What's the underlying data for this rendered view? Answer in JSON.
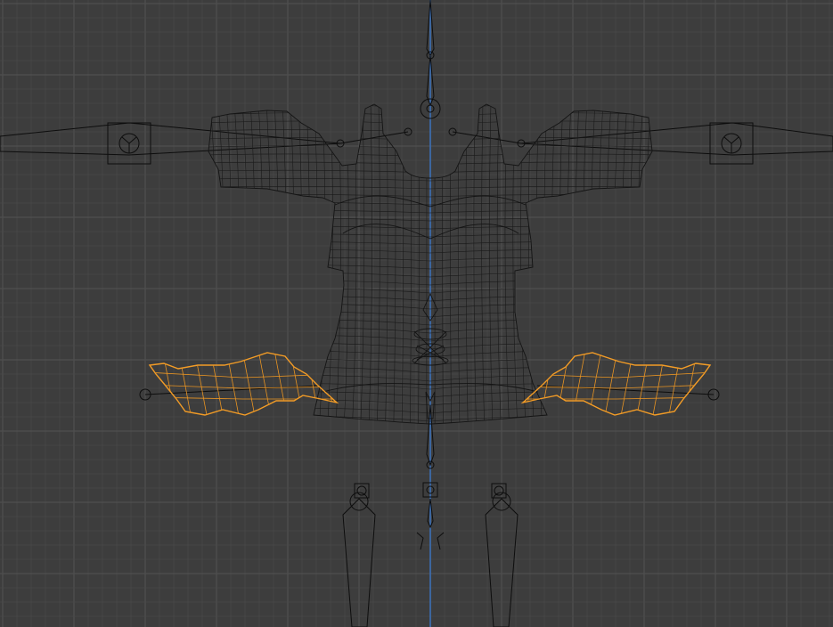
{
  "viewport": {
    "title": "",
    "background_color": "#3d3d3d",
    "grid_color": "#484848",
    "grid_major_color": "#4f4f4f",
    "axis_z_color": "#3b6fb6",
    "wire_color": "#141414",
    "selected_color": "#f39c26"
  },
  "objects": {
    "top_mesh": {
      "label": "",
      "selected": false,
      "icon": "mesh-icon"
    },
    "skirt_left": {
      "label": "",
      "selected": true,
      "icon": "mesh-icon"
    },
    "skirt_right": {
      "label": "",
      "selected": true,
      "icon": "mesh-icon"
    },
    "armature": {
      "label": "",
      "selected": false,
      "icon": "armature-icon"
    }
  }
}
